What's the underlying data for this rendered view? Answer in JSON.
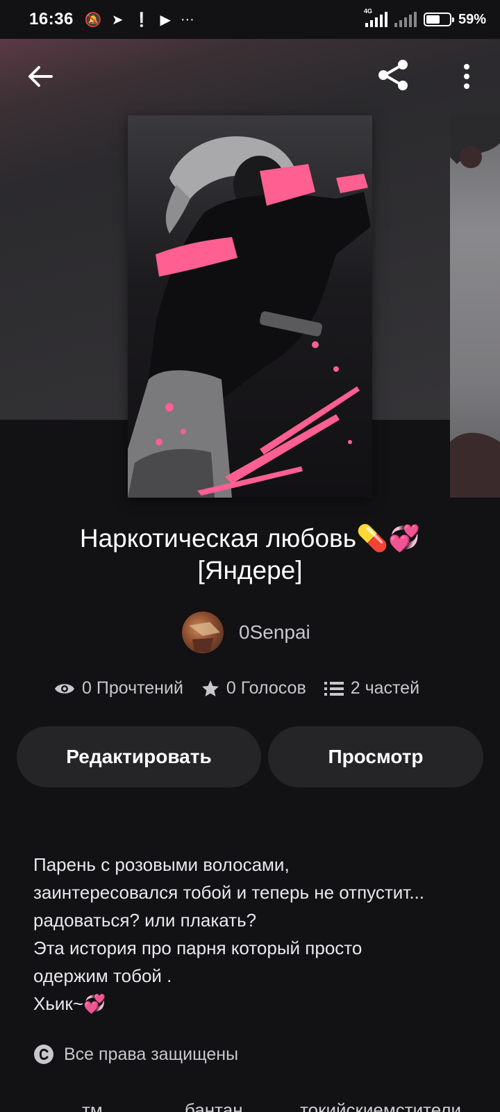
{
  "status": {
    "time": "16:36",
    "battery_pct": "59%",
    "network_label": "4G",
    "battery_level": 0.59
  },
  "story": {
    "title_line1": "Наркотическая любовь💊💞",
    "title_line2": "[Яндере]",
    "author": "0Senpai",
    "reads": "0 Прочтений",
    "votes": "0 Голосов",
    "parts": "2 частей",
    "description": "Парень с розовыми волосами,\nзаинтересовался тобой и теперь не отпустит...\nрадоваться? или плакать?\nЭта история про парня который просто\nодержим тобой .\nХьик~💞",
    "rights": "Все права защищены"
  },
  "actions": {
    "edit_label": "Редактировать",
    "view_label": "Просмотр"
  },
  "tags": [
    "тм",
    "бантан",
    "токийскиемстители"
  ],
  "colors": {
    "background": "#121113",
    "button_bg": "#252427",
    "accent_pink": "#ff5f91"
  },
  "icons": {
    "back": "arrow-left-icon",
    "share": "share-icon",
    "more": "more-vertical-icon",
    "reads": "eye-icon",
    "votes": "star-icon",
    "parts": "list-icon",
    "rights": "copyright-icon"
  }
}
